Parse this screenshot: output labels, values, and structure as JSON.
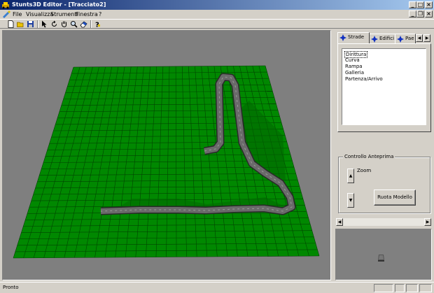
{
  "window": {
    "title": "Stunts3D Editor - [Tracciato2]"
  },
  "menu": {
    "items": [
      "File",
      "Visualizza",
      "Strumenti",
      "Finestra",
      "?"
    ]
  },
  "toolbar": {
    "buttons": [
      "new-document-icon",
      "open-folder-icon",
      "save-disk-icon",
      "pointer-arrow-icon",
      "rotate-icon",
      "hand-pan-icon",
      "zoom-magnifier-icon",
      "eraser-icon",
      "help-question-icon"
    ]
  },
  "panel": {
    "tabs": [
      "Strade",
      "Edifici",
      "Pae"
    ],
    "list": {
      "items": [
        "Dirittura",
        "Curva",
        "Rampa",
        "Galleria",
        "Partenza/Arrivo"
      ],
      "selected": "Dirittura"
    },
    "preview_group": {
      "title": "Controllo Anteprima",
      "zoom_label": "Zoom",
      "rotate_button": "Ruota Modello"
    }
  },
  "status": {
    "text": "Pronto"
  },
  "colors": {
    "terrain": "#008800",
    "grid_line": "#004400",
    "road": "#6a6a6a",
    "viewport_bg": "#7f7f7f"
  }
}
